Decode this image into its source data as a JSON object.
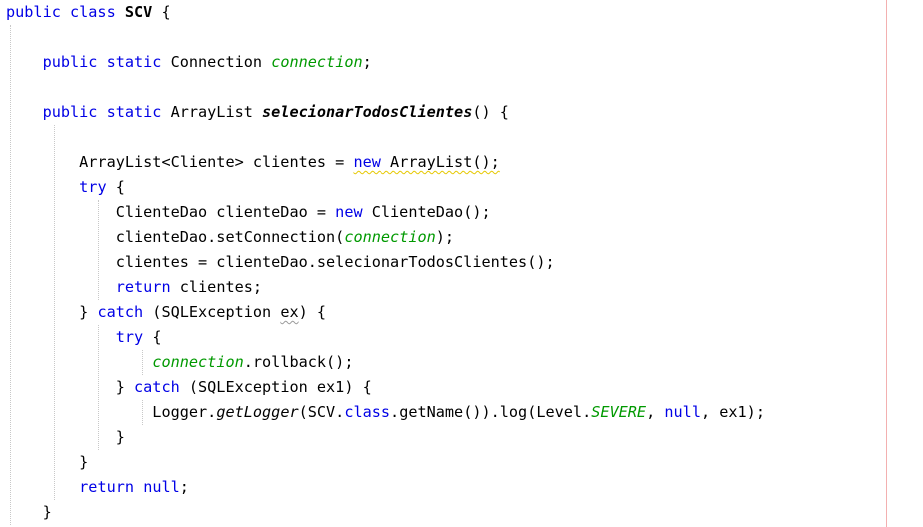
{
  "colors": {
    "keyword": "#0000e6",
    "field": "#009900",
    "text": "#000000",
    "margin_line": "#f3b0b0",
    "warning_underline": "#e6c800"
  },
  "code_lines": [
    [
      {
        "t": "public class ",
        "c": "kw"
      },
      {
        "t": "SCV",
        "c": "bold"
      },
      {
        "t": " {",
        "c": ""
      }
    ],
    [],
    [
      {
        "t": "    ",
        "c": ""
      },
      {
        "t": "public static ",
        "c": "kw"
      },
      {
        "t": "Connection ",
        "c": ""
      },
      {
        "t": "connection",
        "c": "fld"
      },
      {
        "t": ";",
        "c": ""
      }
    ],
    [],
    [
      {
        "t": "    ",
        "c": ""
      },
      {
        "t": "public static ",
        "c": "kw"
      },
      {
        "t": "ArrayList ",
        "c": ""
      },
      {
        "t": "selecionarTodosClientes",
        "c": "bolditalic"
      },
      {
        "t": "() {",
        "c": ""
      }
    ],
    [],
    [
      {
        "t": "        ArrayList<Cliente> clientes = ",
        "c": ""
      },
      {
        "t": "new ArrayList",
        "c": "warn",
        "sub": [
          {
            "t": "new",
            "c": "kw"
          },
          {
            "t": " ArrayList",
            "c": ""
          }
        ]
      },
      {
        "t": "();",
        "c": "warn"
      }
    ],
    [
      {
        "t": "        ",
        "c": ""
      },
      {
        "t": "try",
        "c": "kw"
      },
      {
        "t": " {",
        "c": ""
      }
    ],
    [
      {
        "t": "            ClienteDao clienteDao = ",
        "c": ""
      },
      {
        "t": "new",
        "c": "kw"
      },
      {
        "t": " ClienteDao();",
        "c": ""
      }
    ],
    [
      {
        "t": "            clienteDao.setConnection(",
        "c": ""
      },
      {
        "t": "connection",
        "c": "fld"
      },
      {
        "t": ");",
        "c": ""
      }
    ],
    [
      {
        "t": "            clientes = clienteDao.selecionarTodosClientes();",
        "c": ""
      }
    ],
    [
      {
        "t": "            ",
        "c": ""
      },
      {
        "t": "return",
        "c": "kw"
      },
      {
        "t": " clientes;",
        "c": ""
      }
    ],
    [
      {
        "t": "        } ",
        "c": ""
      },
      {
        "t": "catch",
        "c": "kw"
      },
      {
        "t": " (SQLException ",
        "c": ""
      },
      {
        "t": "ex",
        "c": "hint"
      },
      {
        "t": ") {",
        "c": ""
      }
    ],
    [
      {
        "t": "            ",
        "c": ""
      },
      {
        "t": "try",
        "c": "kw"
      },
      {
        "t": " {",
        "c": ""
      }
    ],
    [
      {
        "t": "                ",
        "c": ""
      },
      {
        "t": "connection",
        "c": "fld"
      },
      {
        "t": ".rollback();",
        "c": ""
      }
    ],
    [
      {
        "t": "            } ",
        "c": ""
      },
      {
        "t": "catch",
        "c": "kw"
      },
      {
        "t": " (SQLException ex1) {",
        "c": ""
      }
    ],
    [
      {
        "t": "                Logger.",
        "c": ""
      },
      {
        "t": "getLogger",
        "c": "ital"
      },
      {
        "t": "(SCV.",
        "c": ""
      },
      {
        "t": "class",
        "c": "kw"
      },
      {
        "t": ".getName()).log(Level.",
        "c": ""
      },
      {
        "t": "SEVERE",
        "c": "fld"
      },
      {
        "t": ", ",
        "c": ""
      },
      {
        "t": "null",
        "c": "kw"
      },
      {
        "t": ", ex1);",
        "c": ""
      }
    ],
    [
      {
        "t": "            }",
        "c": ""
      }
    ],
    [
      {
        "t": "        }",
        "c": ""
      }
    ],
    [
      {
        "t": "        ",
        "c": ""
      },
      {
        "t": "return",
        "c": "kw"
      },
      {
        "t": " ",
        "c": ""
      },
      {
        "t": "null",
        "c": "kw"
      },
      {
        "t": ";",
        "c": ""
      }
    ],
    [
      {
        "t": "    }",
        "c": ""
      }
    ]
  ]
}
